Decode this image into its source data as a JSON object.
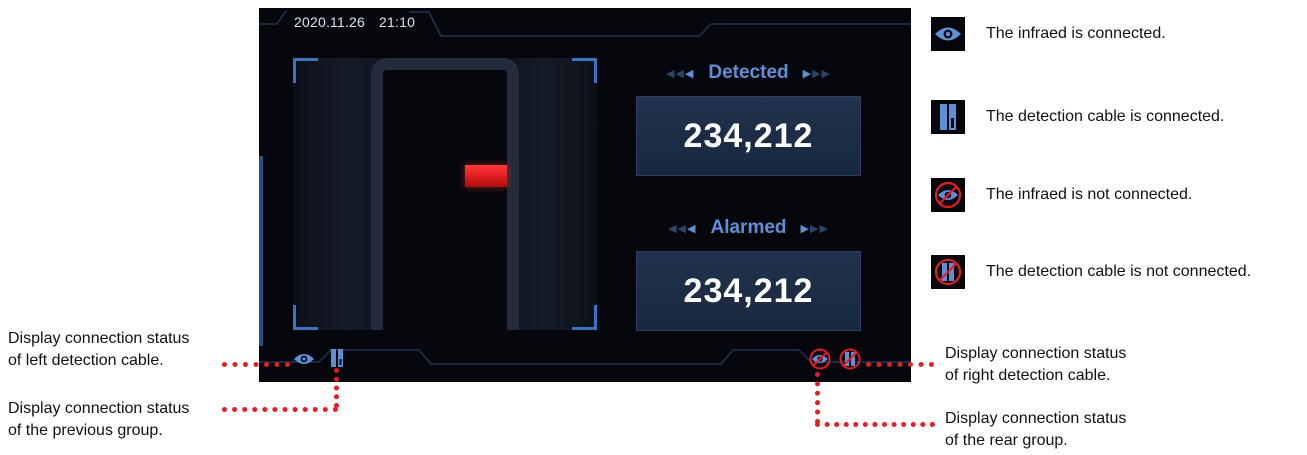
{
  "screen": {
    "date": "2020.11.26",
    "time": "21:10",
    "detected": {
      "label": "Detected",
      "value": "234,212"
    },
    "alarmed": {
      "label": "Alarmed",
      "value": "234,212"
    }
  },
  "legend": [
    {
      "icon": "infrared-connected-icon",
      "text": "The infraed is connected."
    },
    {
      "icon": "detection-cable-connected-icon",
      "text": "The detection cable is connected."
    },
    {
      "icon": "infrared-disconnected-icon",
      "text": "The infraed is not connected."
    },
    {
      "icon": "detection-cable-disconnected-icon",
      "text": "The detection cable is not connected."
    }
  ],
  "callouts": {
    "left_cable": [
      "Display connection status",
      "of left detection cable."
    ],
    "previous_group": [
      "Display connection status",
      "of the previous group."
    ],
    "right_cable": [
      "Display connection status",
      "of right detection cable."
    ],
    "rear_group": [
      "Display connection status",
      "of the rear group."
    ]
  },
  "colors": {
    "accent_blue": "#5f90d6",
    "alarm_red": "#e31e24",
    "screen_bg": "#05070c"
  }
}
